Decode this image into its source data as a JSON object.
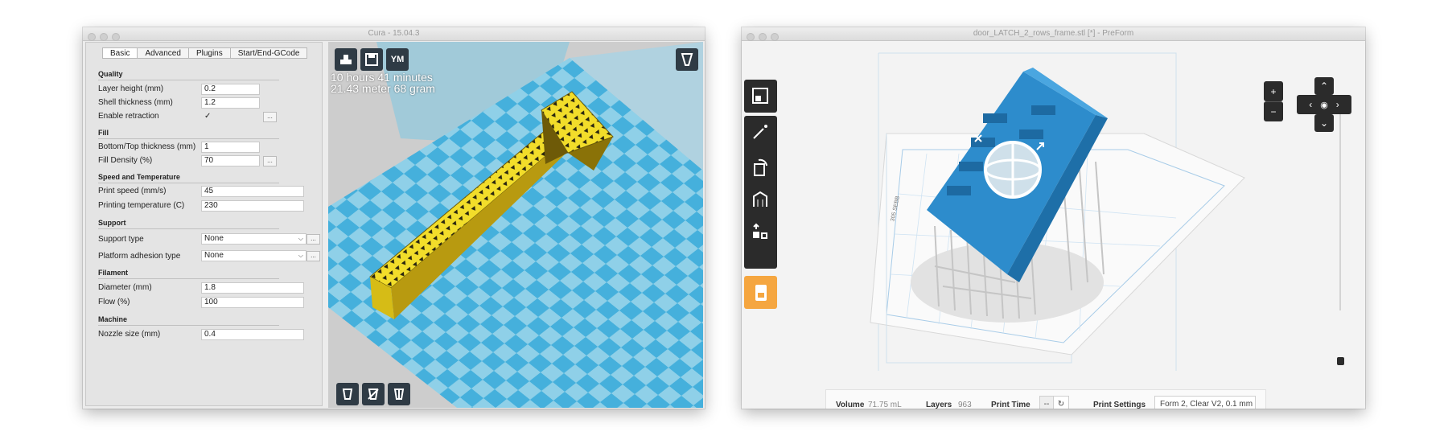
{
  "cura": {
    "title": "Cura - 15.04.3",
    "tabs": [
      "Basic",
      "Advanced",
      "Plugins",
      "Start/End-GCode"
    ],
    "sections": {
      "quality": "Quality",
      "fill": "Fill",
      "speed": "Speed and Temperature",
      "support": "Support",
      "filament": "Filament",
      "machine": "Machine"
    },
    "fields": {
      "layer_height": {
        "label": "Layer height (mm)",
        "value": "0.2"
      },
      "shell_thickness": {
        "label": "Shell thickness (mm)",
        "value": "1.2"
      },
      "retraction": {
        "label": "Enable retraction",
        "value": "✓"
      },
      "bottom_top": {
        "label": "Bottom/Top thickness (mm)",
        "value": "1"
      },
      "fill_density": {
        "label": "Fill Density (%)",
        "value": "70"
      },
      "print_speed": {
        "label": "Print speed (mm/s)",
        "value": "45"
      },
      "print_temp": {
        "label": "Printing temperature (C)",
        "value": "230"
      },
      "support_type": {
        "label": "Support type",
        "value": "None"
      },
      "adhesion": {
        "label": "Platform adhesion type",
        "value": "None"
      },
      "diameter": {
        "label": "Diameter (mm)",
        "value": "1.8"
      },
      "flow": {
        "label": "Flow (%)",
        "value": "100"
      },
      "nozzle": {
        "label": "Nozzle size (mm)",
        "value": "0.4"
      }
    },
    "dots": "...",
    "stats": {
      "time": "10 hours 41 minutes",
      "material": "21.43 meter 68 gram"
    },
    "ym_label": "YM",
    "colors": {
      "model": "#f2dd2a",
      "bed_light": "#8fd0e8",
      "bed_dark": "#45b0dc",
      "toolbar": "#2f3b45"
    }
  },
  "preform": {
    "title": "door_LATCH_2_rows_frame.stl [*] - PreForm",
    "bed_label": "305 SEBB",
    "zoom_in": "+",
    "zoom_out": "−",
    "status": {
      "volume_label": "Volume",
      "volume_value": "71.75 mL",
      "layers_label": "Layers",
      "layers_value": "963",
      "time_label": "Print Time",
      "time_value": "--",
      "settings_label": "Print Settings",
      "settings_value": "Form 2, Clear V2, 0.1 mm"
    },
    "colors": {
      "model": "#2d8ccc",
      "accent": "#f5a640"
    }
  }
}
